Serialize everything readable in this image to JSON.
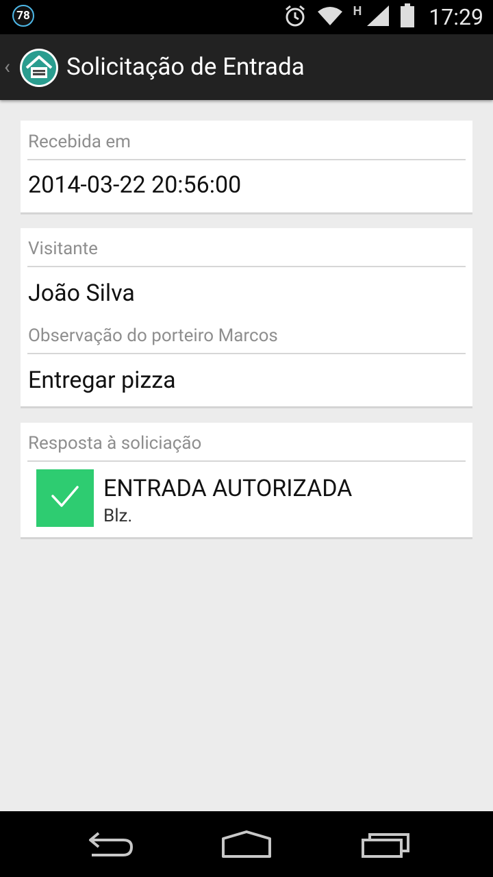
{
  "status_bar": {
    "badge": "78",
    "network_type": "H",
    "time": "17:29"
  },
  "action_bar": {
    "title": "Solicitação de Entrada"
  },
  "received": {
    "label": "Recebida em",
    "value": "2014-03-22 20:56:00"
  },
  "visitor": {
    "label": "Visitante",
    "name": "João Silva",
    "observation_label": "Observação do porteiro Marcos",
    "observation": "Entregar pizza"
  },
  "response": {
    "label": "Resposta à soliciação",
    "status": "ENTRADA AUTORIZADA",
    "note": "Blz.",
    "status_color": "#2ecc71"
  },
  "icons": {
    "back": "back-chevron-icon",
    "app": "house-icon",
    "alarm": "alarm-icon",
    "wifi": "wifi-icon",
    "signal": "signal-icon",
    "battery": "battery-icon",
    "check": "check-icon",
    "nav_back": "nav-back-icon",
    "nav_home": "nav-home-icon",
    "nav_recents": "nav-recents-icon"
  }
}
